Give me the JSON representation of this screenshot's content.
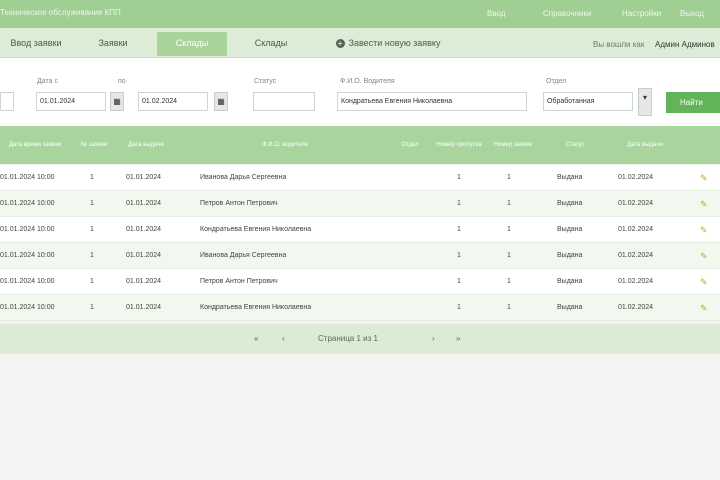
{
  "app": {
    "title": "Техническое обслуживание КПП"
  },
  "header": {
    "links": [
      "Ввод",
      "Справочники",
      "Настройки",
      "Выход"
    ]
  },
  "tabs": [
    {
      "label": "Ввод заявки"
    },
    {
      "label": "Заявки"
    },
    {
      "label": "Склады"
    },
    {
      "label": "Склады"
    }
  ],
  "actions": {
    "add_label": "Завести новую заявку"
  },
  "user": {
    "prefix": "Вы вошли как",
    "name": "Админ Админов"
  },
  "filters": {
    "labels": [
      "Дата с",
      "по",
      "Статус",
      "Ф.И.О. Водителя",
      "Отдел"
    ],
    "date_from": "01.01.2024",
    "date_to": "01.02.2024",
    "number_value": "",
    "driver_value": "Кондратьева Евгения Николаевна",
    "dept_value": "Обработанная",
    "apply_label": "Найти"
  },
  "table": {
    "headers": [
      "Дата время заявки",
      "№ заявки",
      "Дата выдачи",
      "Ф.И.О. водителя",
      "Отдел",
      "Номер пропуска",
      "Номер заявки",
      "Статус",
      "Дата выдачи"
    ],
    "rows": [
      {
        "datetime": "01.01.2024 10:00",
        "num": "1",
        "date": "01.01.2024",
        "name": "Иванова Дарья Сергеевна",
        "p1": "1",
        "p2": "1",
        "status": "Выдана",
        "extra": "01.02.2024"
      },
      {
        "datetime": "01.01.2024 10:00",
        "num": "1",
        "date": "01.01.2024",
        "name": "Петров Антон Петрович",
        "p1": "1",
        "p2": "1",
        "status": "Выдана",
        "extra": "01.02.2024"
      },
      {
        "datetime": "01.01.2024 10:00",
        "num": "1",
        "date": "01.01.2024",
        "name": "Кондратьева Евгения Николаевна",
        "p1": "1",
        "p2": "1",
        "status": "Выдана",
        "extra": "01.02.2024"
      },
      {
        "datetime": "01.01.2024 10:00",
        "num": "1",
        "date": "01.01.2024",
        "name": "Иванова Дарья Сергеевна",
        "p1": "1",
        "p2": "1",
        "status": "Выдана",
        "extra": "01.02.2024"
      },
      {
        "datetime": "01.01.2024 10:00",
        "num": "1",
        "date": "01.01.2024",
        "name": "Петров Антон Петрович",
        "p1": "1",
        "p2": "1",
        "status": "Выдана",
        "extra": "01.02.2024"
      },
      {
        "datetime": "01.01.2024 10:00",
        "num": "1",
        "date": "01.01.2024",
        "name": "Кондратьева Евгения Николаевна",
        "p1": "1",
        "p2": "1",
        "status": "Выдана",
        "extra": "01.02.2024"
      }
    ]
  },
  "pager": {
    "first": "«",
    "prev": "‹",
    "info": "Страница 1 из 1",
    "next": "›",
    "last": "»"
  },
  "icons": {
    "edit": "pencil-icon",
    "calendar": "calendar-icon"
  },
  "colors": {
    "accent": "#a9d49e",
    "topbar": "#9fcf92",
    "button": "#62b35a"
  }
}
